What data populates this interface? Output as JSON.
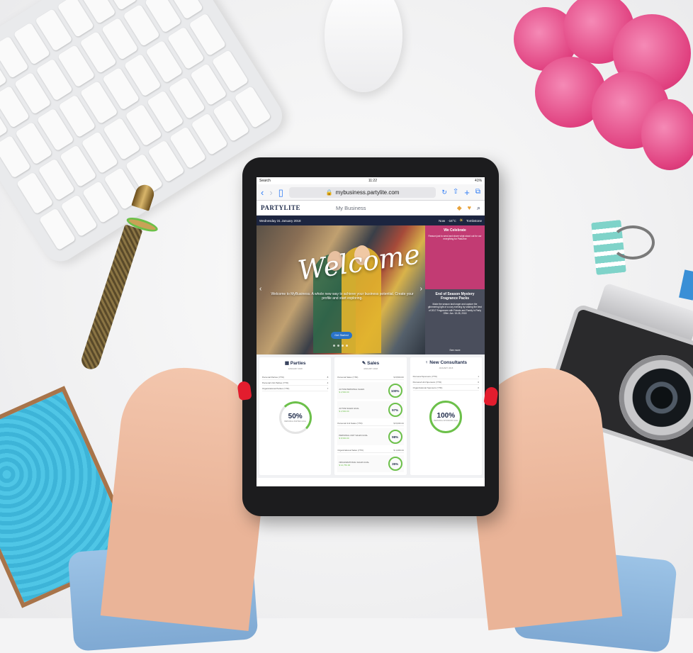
{
  "status": {
    "carrier": "Search",
    "time": "11:22",
    "battery": "41%"
  },
  "safari": {
    "url": "mybusiness.partylite.com"
  },
  "app": {
    "brand": "PARTYLITE",
    "title": "My Business"
  },
  "datebar": {
    "date": "Wednesday 31 January 2018",
    "weather_label": "Now",
    "temp": "-16°C",
    "city": "Tombstone"
  },
  "hero": {
    "welcome": "Welcome",
    "subtitle": "Welcome to MyBusiness. A whole new way to achieve your business potential. Create your profile and start exploring.",
    "cta": "Get Started"
  },
  "celebrate": {
    "title": "We Celebrate",
    "text": "Reason just to send and share what stood out for our everything for ParkZine"
  },
  "season": {
    "title": "End of Season Mystery Fragrance Packs",
    "text": "Make the season last longer and capture the glimmering light of a cozy evening by sharing the best of 2017 Fragrances with Friends and Family in Party Offer: Jan. 15-28, 2018",
    "more": "See more"
  },
  "parties": {
    "title": "Parties",
    "sub": "JANUARY 2018",
    "rows": [
      [
        "Personal Parties (YTD)",
        "8"
      ],
      [
        "Personal Unit Parties (YTD)",
        "4"
      ],
      [
        "Organizational Parties (YTD)",
        "7"
      ]
    ],
    "pct": "50%",
    "pct_label": "PERSONAL PARTIES GOAL"
  },
  "sales": {
    "title": "Sales",
    "sub": "JANUARY 2018",
    "personal": [
      "Personal Sales (YTD)",
      "$ 8,500.00"
    ],
    "mini1": {
      "label": "ACTIVE PERSONAL SALES",
      "amt": "$ 2,500.00",
      "pct": "100%"
    },
    "mini2": {
      "label": "ACTIVE SALES GOAL",
      "amt": "$ 2,500.00",
      "pct": "97%"
    },
    "unit": [
      "Personal Unit Sales (YTD)",
      "$ 8,333.44"
    ],
    "mini3": {
      "label": "PERSONAL UNIT SALES GOAL",
      "amt": "$ 8,500.00",
      "pct": "98%"
    },
    "org": [
      "Organizational Sales (YTD)",
      "$ 4,409.44"
    ],
    "mini4": {
      "label": "ORGANIZATIONAL SALES GOAL",
      "amt": "$ 12,750.00",
      "pct": "35%"
    }
  },
  "consultants": {
    "title": "New Consultants",
    "sub": "JANUARY 2018",
    "rows": [
      [
        "Personal Sponsors (YTD)",
        "1"
      ],
      [
        "Personal Unit Sponsors (YTD)",
        "0"
      ],
      [
        "Organizational Sponsors (YTD)",
        "0"
      ]
    ],
    "pct": "100%",
    "pct_label": "PERSONAL SPONSORS GOAL"
  }
}
